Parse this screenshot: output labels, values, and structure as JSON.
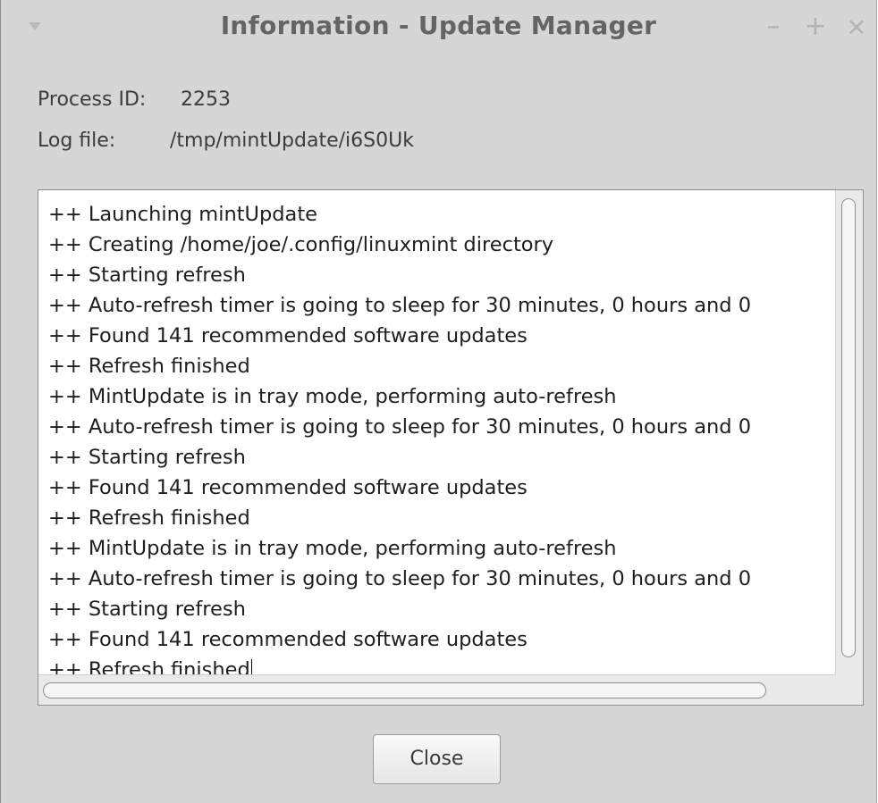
{
  "window": {
    "title": "Information - Update Manager",
    "controls": {
      "minimize": "–",
      "maximize": "+",
      "close": "×"
    }
  },
  "info": {
    "process_id_label": "Process ID:",
    "process_id_value": "2253",
    "log_file_label": "Log file:",
    "log_file_value": "/tmp/mintUpdate/i6S0Uk"
  },
  "log": {
    "lines": [
      "++ Launching mintUpdate",
      "++ Creating /home/joe/.config/linuxmint directory",
      "++ Starting refresh",
      "++ Auto-refresh timer is going to sleep for 30 minutes, 0 hours and 0",
      "++ Found 141 recommended software updates",
      "++ Refresh finished",
      "++ MintUpdate is in tray mode, performing auto-refresh",
      "++ Auto-refresh timer is going to sleep for 30 minutes, 0 hours and 0",
      "++ Starting refresh",
      "++ Found 141 recommended software updates",
      "++ Refresh finished",
      "++ MintUpdate is in tray mode, performing auto-refresh",
      "++ Auto-refresh timer is going to sleep for 30 minutes, 0 hours and 0",
      "++ Starting refresh",
      "++ Found 141 recommended software updates",
      "++ Refresh finished"
    ]
  },
  "buttons": {
    "close_label": "Close"
  },
  "colors": {
    "window_bg": "#d6d6d6",
    "title_text": "#646464",
    "log_bg": "#ffffff"
  },
  "icons": {
    "menu": "chevron-down-icon",
    "minimize": "minimize-icon",
    "maximize": "maximize-icon",
    "close": "close-icon"
  }
}
